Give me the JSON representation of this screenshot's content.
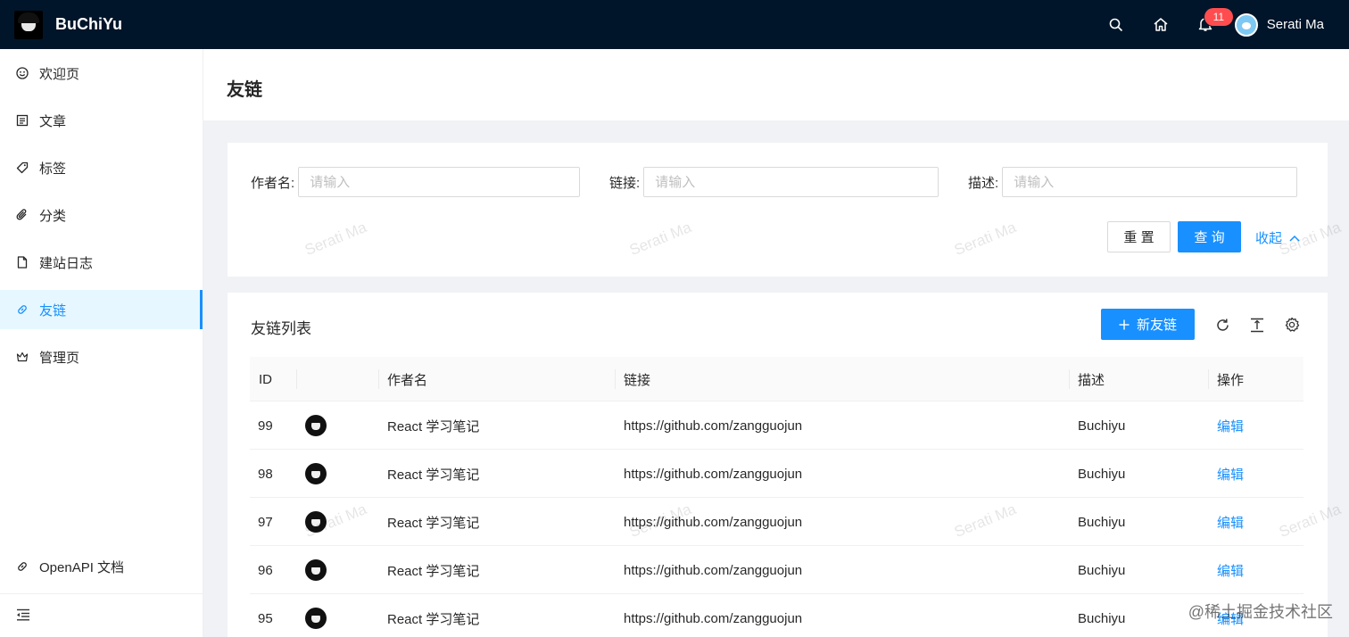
{
  "header": {
    "app_title": "BuChiYu",
    "notification_count": "11",
    "user_name": "Serati Ma",
    "bg_color": "#001529"
  },
  "sidebar": {
    "items": [
      {
        "label": "欢迎页",
        "icon": "smile-icon"
      },
      {
        "label": "文章",
        "icon": "profile-icon"
      },
      {
        "label": "标签",
        "icon": "tag-icon"
      },
      {
        "label": "分类",
        "icon": "paperclip-icon"
      },
      {
        "label": "建站日志",
        "icon": "file-icon"
      },
      {
        "label": "友链",
        "icon": "link-icon",
        "active": true
      },
      {
        "label": "管理页",
        "icon": "crown-icon"
      }
    ],
    "bottom_link": "OpenAPI 文档"
  },
  "page": {
    "title": "友链"
  },
  "search": {
    "fields": [
      {
        "label": "作者名",
        "placeholder": "请输入"
      },
      {
        "label": "链接",
        "placeholder": "请输入"
      },
      {
        "label": "描述",
        "placeholder": "请输入"
      }
    ],
    "reset_label": "重 置",
    "query_label": "查 询",
    "collapse_label": "收起"
  },
  "table": {
    "title": "友链列表",
    "new_button": "新友链",
    "columns": [
      "ID",
      "",
      "作者名",
      "链接",
      "描述",
      "操作"
    ],
    "rows": [
      {
        "id": "99",
        "author": "React 学习笔记",
        "link": "https://github.com/zangguojun",
        "desc": "Buchiyu",
        "action": "编辑"
      },
      {
        "id": "98",
        "author": "React 学习笔记",
        "link": "https://github.com/zangguojun",
        "desc": "Buchiyu",
        "action": "编辑"
      },
      {
        "id": "97",
        "author": "React 学习笔记",
        "link": "https://github.com/zangguojun",
        "desc": "Buchiyu",
        "action": "编辑"
      },
      {
        "id": "96",
        "author": "React 学习笔记",
        "link": "https://github.com/zangguojun",
        "desc": "Buchiyu",
        "action": "编辑"
      },
      {
        "id": "95",
        "author": "React 学习笔记",
        "link": "https://github.com/zangguojun",
        "desc": "Buchiyu",
        "action": "编辑"
      }
    ]
  },
  "watermark": "Serati Ma",
  "site_watermark": "@稀土掘金技术社区",
  "colors": {
    "primary": "#1890ff",
    "danger": "#ff4d4f",
    "active_bg": "#e6f7ff"
  }
}
